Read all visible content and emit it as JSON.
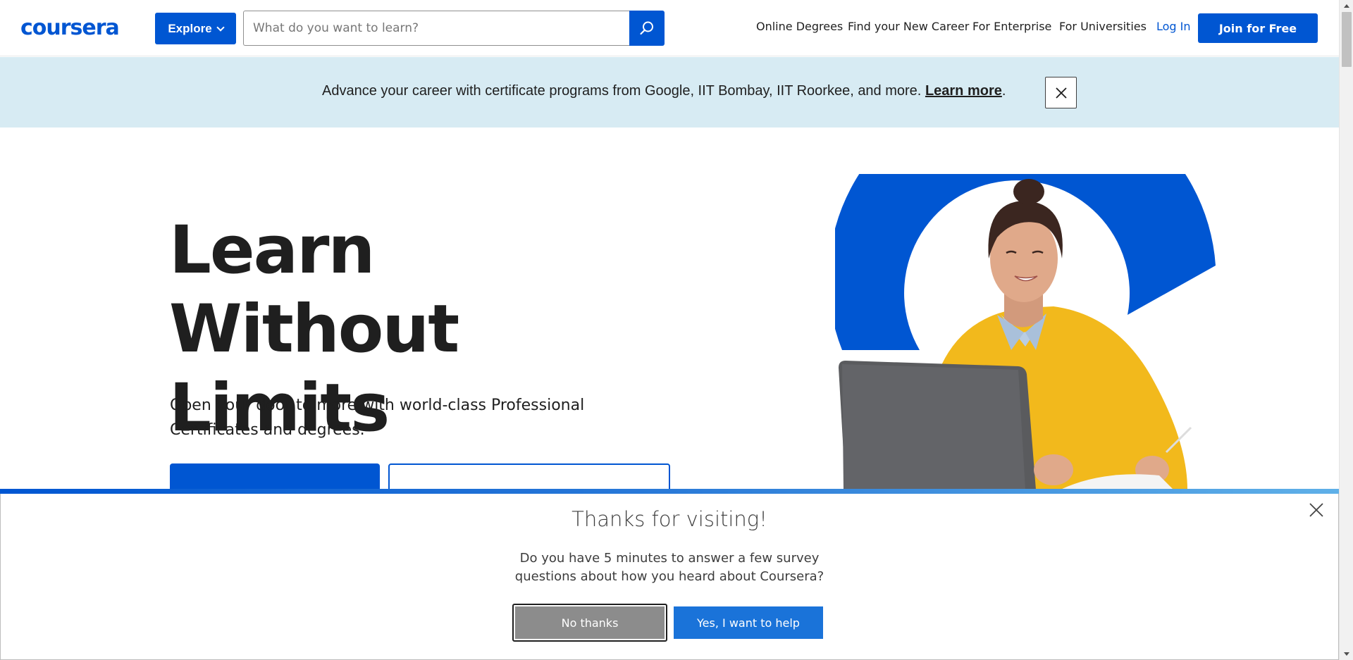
{
  "header": {
    "logo_text": "coursera",
    "explore_label": "Explore",
    "search_placeholder": "What do you want to learn?",
    "nav": [
      {
        "label": "Online Degrees"
      },
      {
        "label": "Find your New Career"
      },
      {
        "label": "For Enterprise"
      },
      {
        "label": "For Universities"
      }
    ],
    "login_label": "Log In",
    "join_label": "Join for Free"
  },
  "banner": {
    "text": "Advance your career with certificate programs from Google, IIT Bombay, IIT Roorkee, and more.",
    "link_text": "Learn more",
    "trailing": "."
  },
  "hero": {
    "title": "Learn Without Limits",
    "subtitle": "Open your door to more with world-class Professional Certificates and degrees."
  },
  "survey": {
    "title": "Thanks for visiting!",
    "text": "Do you have 5 minutes to answer a few survey questions about how you heard about Coursera?",
    "no_label": "No thanks",
    "yes_label": "Yes, I want to help"
  },
  "colors": {
    "brand_blue": "#0056d2",
    "banner_bg": "#d7ebf3",
    "sweater_yellow": "#f2b91c"
  }
}
